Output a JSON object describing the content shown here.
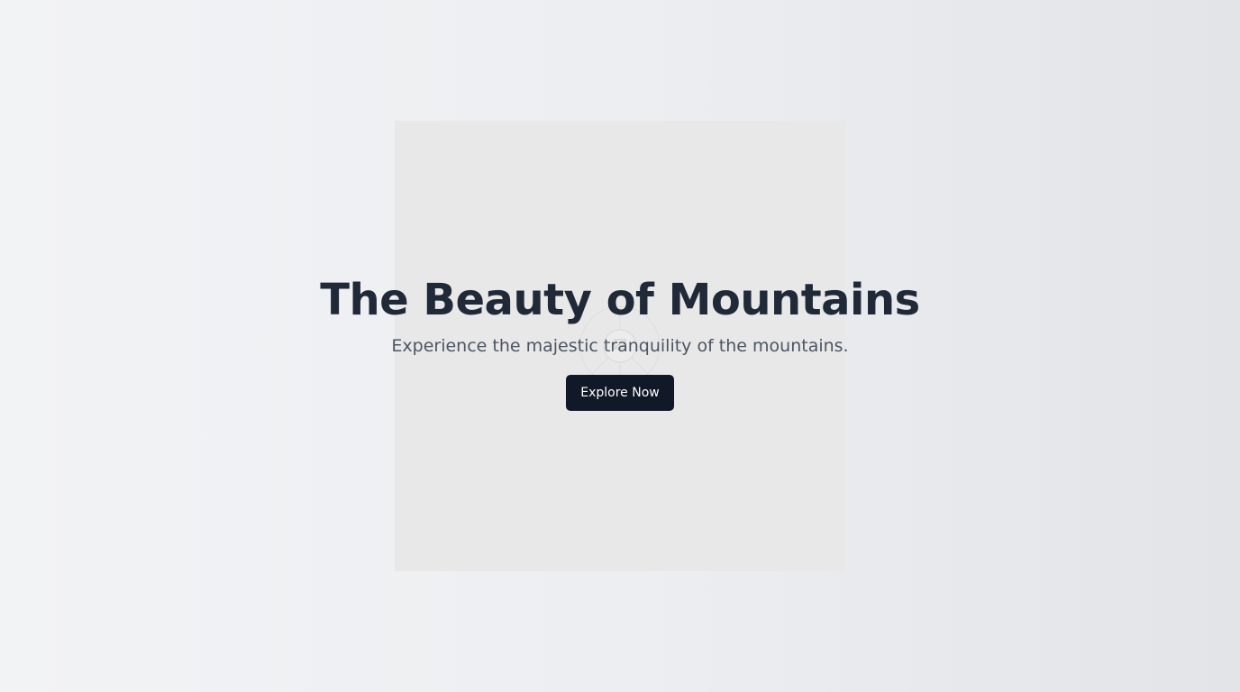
{
  "hero": {
    "image_icon": "image-placeholder-icon",
    "title": "The Beauty of Mountains",
    "subtitle": "Experience the majestic tranquility of the mountains.",
    "cta_label": "Explore Now"
  },
  "colors": {
    "title": "#1f2937",
    "subtitle": "#4b5563",
    "button_bg": "#111827",
    "button_text": "#ffffff",
    "image_bg": "#e8e8e8"
  }
}
